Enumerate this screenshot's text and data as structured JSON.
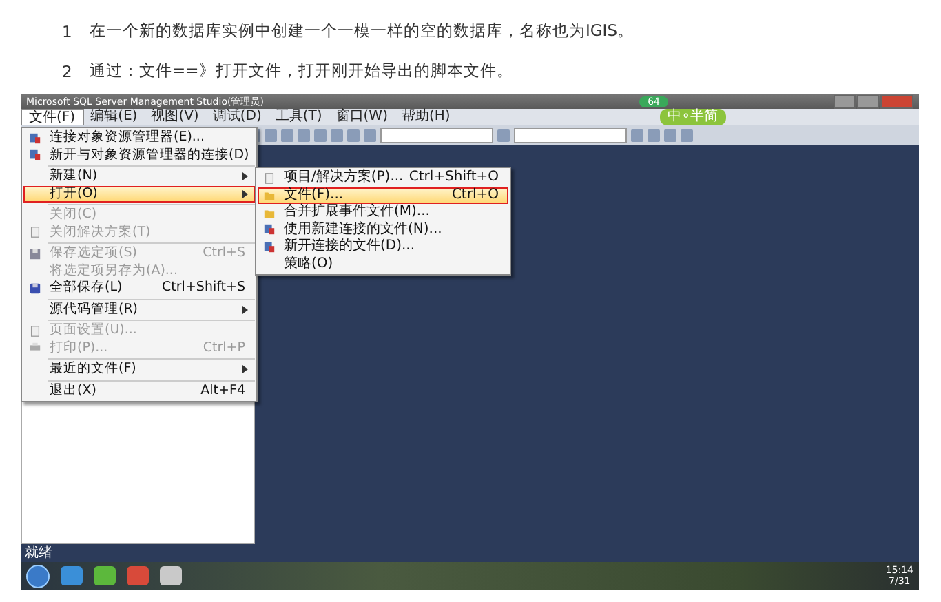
{
  "steps": [
    {
      "number": "1",
      "text": "在一个新的数据库实例中创建一个一模一样的空的数据库，名称也为IGIS。"
    },
    {
      "number": "2",
      "text": "通过：文件==》打开文件，打开刚开始导出的脚本文件。"
    }
  ],
  "screenshot": {
    "title": "Microsoft SQL Server Management Studio(管理员)",
    "badge": "64",
    "ime": "中∘半简",
    "menubar": [
      {
        "label": "文件(F)",
        "selected": true
      },
      {
        "label": "编辑(E)",
        "selected": false
      },
      {
        "label": "视图(V)",
        "selected": false
      },
      {
        "label": "调试(D)",
        "selected": false
      },
      {
        "label": "工具(T)",
        "selected": false
      },
      {
        "label": "窗口(W)",
        "selected": false
      },
      {
        "label": "帮助(H)",
        "selected": false
      }
    ],
    "file_menu": [
      {
        "kind": "item",
        "label": "连接对象资源管理器(E)...",
        "disabled": false,
        "selected": false
      },
      {
        "kind": "item",
        "label": "新开与对象资源管理器的连接(D)",
        "disabled": false,
        "selected": false
      },
      {
        "kind": "separator"
      },
      {
        "kind": "item",
        "label": "新建(N)",
        "submenu": true,
        "disabled": false,
        "selected": false
      },
      {
        "kind": "item",
        "label": "打开(O)",
        "submenu": true,
        "disabled": false,
        "selected": true
      },
      {
        "kind": "separator"
      },
      {
        "kind": "item",
        "label": "关闭(C)",
        "disabled": true,
        "selected": false
      },
      {
        "kind": "item",
        "label": "关闭解决方案(T)",
        "disabled": true,
        "selected": false
      },
      {
        "kind": "separator"
      },
      {
        "kind": "item",
        "label": "保存选定项(S)",
        "shortcut": "Ctrl+S",
        "disabled": true,
        "selected": false
      },
      {
        "kind": "item",
        "label": "将选定项另存为(A)...",
        "disabled": true,
        "selected": false
      },
      {
        "kind": "item",
        "label": "全部保存(L)",
        "shortcut": "Ctrl+Shift+S",
        "disabled": false,
        "selected": false
      },
      {
        "kind": "separator"
      },
      {
        "kind": "item",
        "label": "源代码管理(R)",
        "submenu": true,
        "disabled": false,
        "selected": false
      },
      {
        "kind": "separator"
      },
      {
        "kind": "item",
        "label": "页面设置(U)...",
        "disabled": true,
        "selected": false
      },
      {
        "kind": "item",
        "label": "打印(P)...",
        "shortcut": "Ctrl+P",
        "disabled": true,
        "selected": false
      },
      {
        "kind": "separator"
      },
      {
        "kind": "item",
        "label": "最近的文件(F)",
        "submenu": true,
        "disabled": false,
        "selected": false
      },
      {
        "kind": "separator"
      },
      {
        "kind": "item",
        "label": "退出(X)",
        "shortcut": "Alt+F4",
        "disabled": false,
        "selected": false
      }
    ],
    "open_submenu": [
      {
        "kind": "item",
        "label": "项目/解决方案(P)...",
        "shortcut": "Ctrl+Shift+O",
        "selected": false
      },
      {
        "kind": "item",
        "label": "文件(F)...",
        "shortcut": "Ctrl+O",
        "selected": true
      },
      {
        "kind": "item",
        "label": "合并扩展事件文件(M)...",
        "selected": false
      },
      {
        "kind": "item",
        "label": "使用新建连接的文件(N)...",
        "selected": false
      },
      {
        "kind": "item",
        "label": "新开连接的文件(D)...",
        "selected": false
      },
      {
        "kind": "item",
        "label": "策略(O)",
        "selected": false
      }
    ],
    "status": "就绪",
    "taskbar": {
      "clock": "15:14",
      "date": "7/31"
    }
  }
}
